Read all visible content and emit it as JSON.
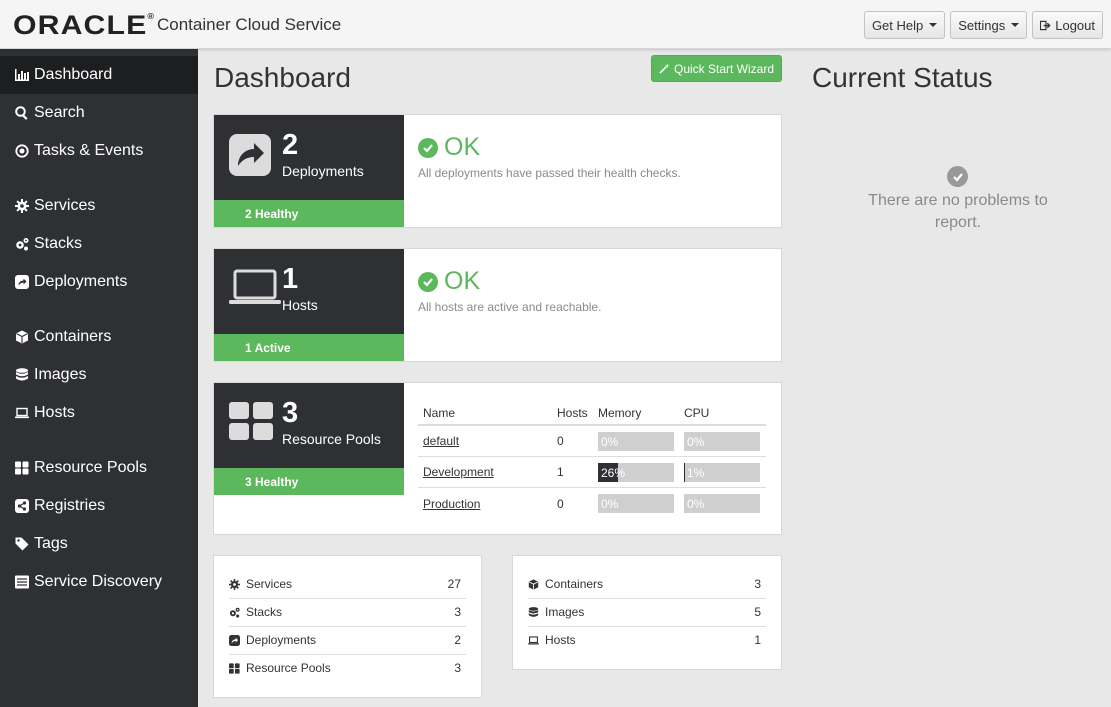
{
  "header": {
    "brand": "ORACLE",
    "app_title": "Container Cloud Service",
    "get_help": "Get Help",
    "settings": "Settings",
    "logout": "Logout"
  },
  "sidebar": {
    "items": [
      {
        "label": "Dashboard",
        "icon": "bar-chart-icon"
      },
      {
        "label": "Search",
        "icon": "search-icon"
      },
      {
        "label": "Tasks & Events",
        "icon": "dot-circle-icon"
      },
      {
        "label": "Services",
        "icon": "gear-icon"
      },
      {
        "label": "Stacks",
        "icon": "gears-icon"
      },
      {
        "label": "Deployments",
        "icon": "share-square-icon"
      },
      {
        "label": "Containers",
        "icon": "cube-icon"
      },
      {
        "label": "Images",
        "icon": "database-icon"
      },
      {
        "label": "Hosts",
        "icon": "laptop-icon"
      },
      {
        "label": "Resource Pools",
        "icon": "grid-icon"
      },
      {
        "label": "Registries",
        "icon": "share-alt-icon"
      },
      {
        "label": "Tags",
        "icon": "tag-icon"
      },
      {
        "label": "Service Discovery",
        "icon": "list-icon"
      }
    ]
  },
  "main": {
    "title": "Dashboard",
    "quick_start": "Quick Start Wizard",
    "deployments": {
      "count": "2",
      "label": "Deployments",
      "footer": "2 Healthy",
      "status": "OK",
      "desc": "All deployments have passed their health checks."
    },
    "hosts": {
      "count": "1",
      "label": "Hosts",
      "footer": "1 Active",
      "status": "OK",
      "desc": "All hosts are active and reachable."
    },
    "pools": {
      "count": "3",
      "label": "Resource Pools",
      "footer": "3 Healthy",
      "headers": {
        "name": "Name",
        "hosts": "Hosts",
        "memory": "Memory",
        "cpu": "CPU"
      },
      "rows": [
        {
          "name": "default",
          "hosts": "0",
          "memory": "0%",
          "memory_pct": 0,
          "cpu": "0%",
          "cpu_pct": 0
        },
        {
          "name": "Development",
          "hosts": "1",
          "memory": "26%",
          "memory_pct": 26,
          "cpu": "1%",
          "cpu_pct": 1
        },
        {
          "name": "Production",
          "hosts": "0",
          "memory": "0%",
          "memory_pct": 0,
          "cpu": "0%",
          "cpu_pct": 0
        }
      ]
    },
    "counts_left": [
      {
        "label": "Services",
        "value": "27",
        "icon": "gear-icon"
      },
      {
        "label": "Stacks",
        "value": "3",
        "icon": "gears-icon"
      },
      {
        "label": "Deployments",
        "value": "2",
        "icon": "share-square-icon"
      },
      {
        "label": "Resource Pools",
        "value": "3",
        "icon": "grid-icon"
      }
    ],
    "counts_right": [
      {
        "label": "Containers",
        "value": "3",
        "icon": "cube-icon"
      },
      {
        "label": "Images",
        "value": "5",
        "icon": "database-icon"
      },
      {
        "label": "Hosts",
        "value": "1",
        "icon": "laptop-icon"
      }
    ]
  },
  "status": {
    "title": "Current Status",
    "message": "There are no problems to report."
  },
  "colors": {
    "accent_green": "#5cb85c",
    "sidebar_bg": "#2e3033",
    "sidebar_active": "#1d1e20"
  }
}
